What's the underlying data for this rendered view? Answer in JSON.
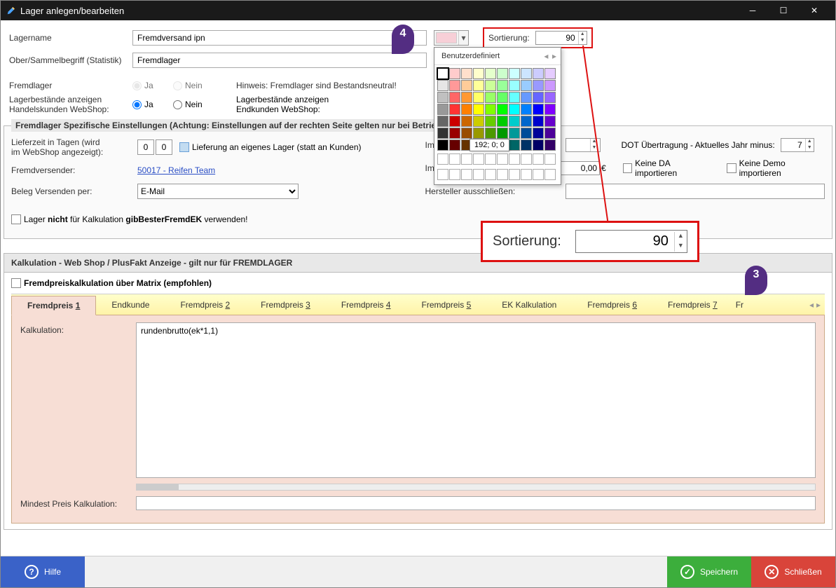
{
  "window": {
    "title": "Lager anlegen/bearbeiten"
  },
  "labels": {
    "lagername": "Lagername",
    "oberbegriff": "Ober/Sammelbegriff (Statistik)",
    "fremdlager": "Fremdlager",
    "ja": "Ja",
    "nein": "Nein",
    "hinweis_fremdlager": "Hinweis: Fremdlager sind Bestandsneutral!",
    "lagerbest_handel_1": "Lagerbestände anzeigen",
    "lagerbest_handel_2": "Handelskunden WebShop:",
    "lagerbest_end_1": "Lagerbestände anzeigen",
    "lagerbest_end_2": "Endkunden WebShop:",
    "sortierung": "Sortierung:"
  },
  "values": {
    "lagername": "Fremdversand ipn",
    "oberbegriff": "Fremdlager",
    "sortierung": "90",
    "sortierung_big": "90"
  },
  "color_popup": {
    "tab": "Benutzerdefiniert",
    "tooltip": "192; 0; 0"
  },
  "fieldset1": {
    "legend": "Fremdlager Spezifische Einstellungen (Achtung: Einstellungen auf der rechten Seite gelten nur bei Betrieb mit eigenem Server)",
    "lieferzeit_1": "Lieferzeit in Tagen (wird",
    "lieferzeit_2": "im WebShop angezeigt):",
    "lief_tage_a": "0",
    "lief_tage_b": "0",
    "lieferung_eigen": "Lieferung an eigenes Lager (statt an Kunden)",
    "fremdversender": "Fremdversender:",
    "fremdversender_link": "50017 - Reifen Team",
    "beleg_versenden": "Beleg Versenden per:",
    "beleg_value": "E-Mail",
    "lager_nicht_pre": "Lager ",
    "lager_nicht_b": "nicht",
    "lager_nicht_mid": " für Kalkulation ",
    "lager_nicht_b2": "gibBesterFremdEK",
    "lager_nicht_post": " verwenden!",
    "import_menge": "Import nur wenn Menge >=",
    "import_preis": "Import nur wenn Preis >=",
    "import_preis_val": "0,00",
    "eur": "€",
    "hersteller": "Hersteller ausschließen:",
    "dot": "DOT Übertragung - Aktuelles Jahr minus:",
    "dot_val": "7",
    "keine_da": "Keine DA importieren",
    "keine_demo": "Keine Demo importieren"
  },
  "kalk": {
    "header": "Kalkulation - Web Shop / PlusFakt Anzeige - gilt nur für FREMDLAGER",
    "matrix_cb": "Fremdpreiskalkulation über Matrix (empfohlen)",
    "tabs": [
      "Fremdpreis 1",
      "Endkunde",
      "Fremdpreis 2",
      "Fremdpreis 3",
      "Fremdpreis 4",
      "Fremdpreis 5",
      "EK Kalkulation",
      "Fremdpreis 6",
      "Fremdpreis 7",
      "Fr"
    ],
    "kalkulation_lbl": "Kalkulation:",
    "formula": "rundenbrutto(ek*1,1)",
    "mindest_lbl": "Mindest Preis Kalkulation:"
  },
  "footer": {
    "hilfe": "Hilfe",
    "speichern": "Speichern",
    "schliessen": "Schließen"
  },
  "anno": {
    "n3": "3",
    "n4": "4"
  }
}
